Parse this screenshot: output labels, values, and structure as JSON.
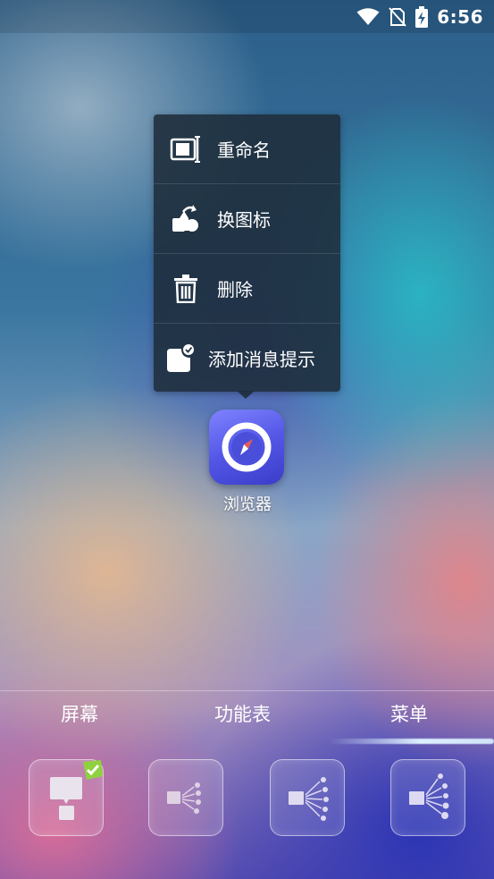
{
  "status_bar": {
    "time": "6:56",
    "icons": [
      "wifi-icon",
      "no-sim-icon",
      "battery-charging-icon"
    ]
  },
  "context_menu": {
    "items": [
      {
        "label": "重命名",
        "icon": "rename-icon"
      },
      {
        "label": "换图标",
        "icon": "change-icon-icon"
      },
      {
        "label": "删除",
        "icon": "trash-icon"
      },
      {
        "label": "添加消息提示",
        "icon": "badge-notification-icon"
      }
    ]
  },
  "app": {
    "label": "浏览器",
    "icon": "compass-icon",
    "color": "#5a5de8"
  },
  "dock": {
    "tabs": [
      {
        "label": "屏幕"
      },
      {
        "label": "功能表"
      },
      {
        "label": "菜单"
      }
    ],
    "active_tab": "菜单",
    "accent_color": "#8fd13f",
    "tiles": [
      {
        "icon": "screen-layout-icon",
        "selected": true
      },
      {
        "icon": "menu-spread-small-icon",
        "selected": false
      },
      {
        "icon": "menu-spread-medium-icon",
        "selected": false
      },
      {
        "icon": "menu-spread-large-icon",
        "selected": false
      }
    ]
  }
}
